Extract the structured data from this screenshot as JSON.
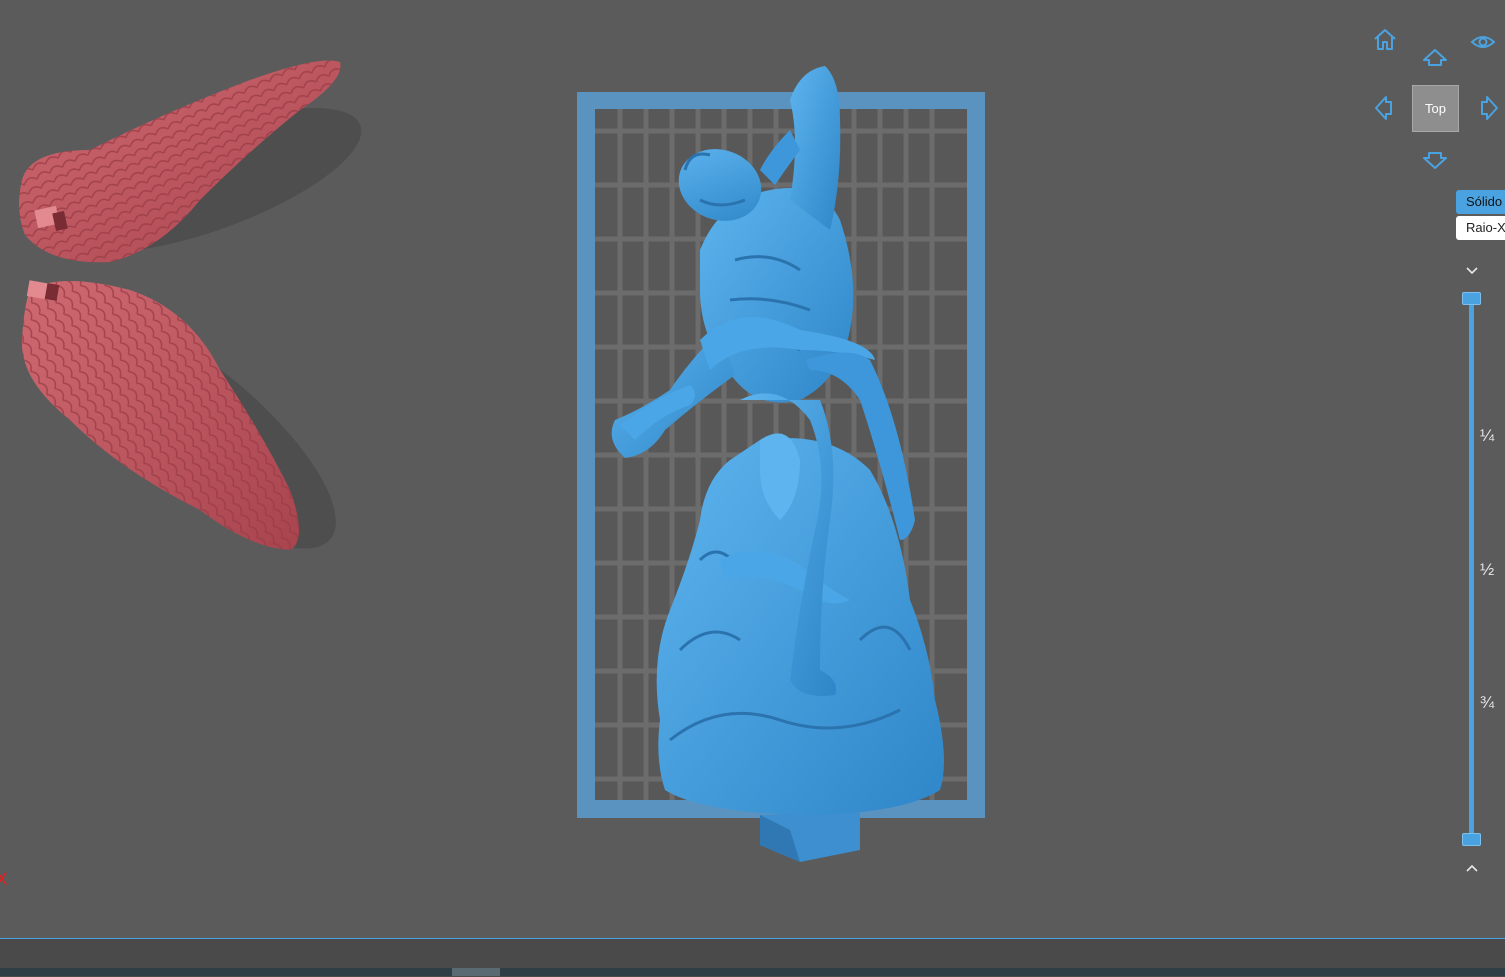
{
  "viewport": {
    "background": "#5b5b5b",
    "model_color": "#4aa3e0",
    "wing_color": "#c45a62",
    "plate_color": "#5b93c0"
  },
  "view_cube": {
    "face_label": "Top",
    "icons": [
      "home-icon",
      "eye-icon",
      "arrow-up-icon",
      "arrow-left-icon",
      "arrow-right-icon",
      "arrow-down-icon"
    ]
  },
  "render_modes": {
    "solid_label": "Sólido",
    "xray_label": "Raio-X",
    "active": "Sólido"
  },
  "layer_slider": {
    "marks": [
      "¼",
      "½",
      "¾"
    ],
    "top_icon": "chevron-down-icon",
    "bottom_icon": "chevron-up-icon",
    "range_start": 0,
    "range_end": 1
  },
  "axis_indicator": {
    "label": "X",
    "color": "#e02020"
  }
}
